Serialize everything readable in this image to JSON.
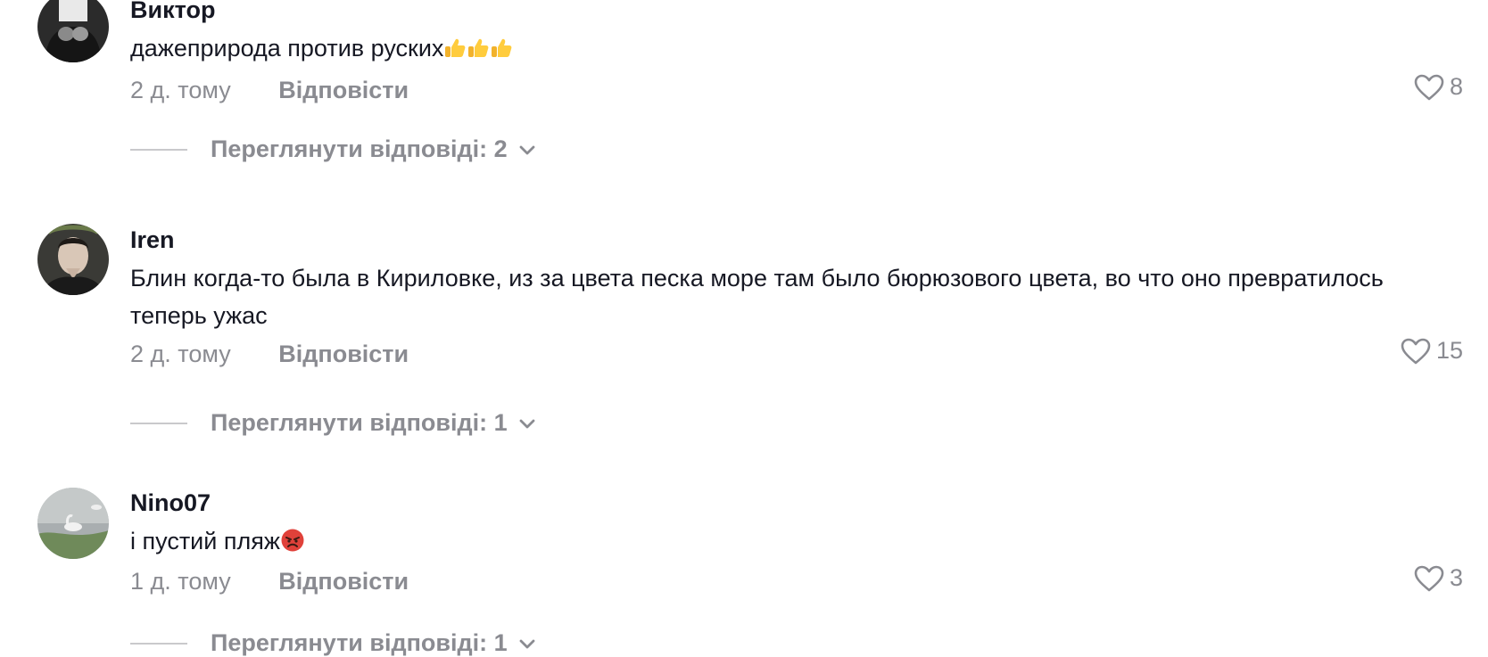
{
  "comments": [
    {
      "username": "Виктор",
      "text": "дажеприрода против руских",
      "time": "2 д. тому",
      "reply_label": "Відповісти",
      "likes": "8",
      "view_replies": "Переглянути відповіді: 2",
      "emoji": [
        "thumbs-up-icon",
        "thumbs-up-icon",
        "thumbs-up-icon"
      ]
    },
    {
      "username": "Iren",
      "text": "Блин когда-то была в Кириловке, из за цвета песка море там было бюрюзового цвета, во что оно превратилось теперь ужас",
      "time": "2 д. тому",
      "reply_label": "Відповісти",
      "likes": "15",
      "view_replies": "Переглянути відповіді: 1"
    },
    {
      "username": "Nino07",
      "text": "і пустий пляж",
      "time": "1 д. тому",
      "reply_label": "Відповісти",
      "likes": "3",
      "view_replies": "Переглянути відповіді: 1",
      "emoji": [
        "angry-face-icon"
      ]
    }
  ],
  "icons": {
    "like": "heart-outline-icon",
    "expand": "chevron-down-icon"
  },
  "colors": {
    "primary_text": "#161823",
    "secondary_text": "#8a8b91",
    "divider": "#c9c9cc"
  }
}
